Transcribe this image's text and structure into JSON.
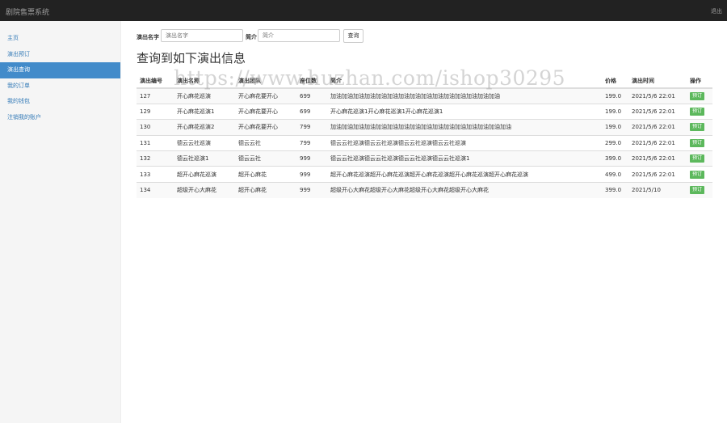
{
  "app": {
    "title": "剧院售票系统",
    "logout_label": "退出"
  },
  "sidebar": {
    "items": [
      {
        "label": "主页",
        "active": false
      },
      {
        "label": "演出预订",
        "active": false
      },
      {
        "label": "演出查询",
        "active": true
      },
      {
        "label": "我的订单",
        "active": false
      },
      {
        "label": "我的钱包",
        "active": false
      },
      {
        "label": "注销我的账户",
        "active": false
      }
    ]
  },
  "search": {
    "name_label": "演出名字",
    "name_placeholder": "演出名字",
    "desc_label": "简介",
    "desc_placeholder": "简介",
    "button_label": "查询"
  },
  "page_title": "查询到如下演出信息",
  "watermark": "https://www.huzhan.com/ishop30295",
  "table": {
    "headers": [
      "演出编号",
      "演出名称",
      "演出团队",
      "座位数",
      "简介",
      "价格",
      "演出时间",
      "操作"
    ],
    "rows": [
      [
        "127",
        "开心麻花巡演",
        "开心麻花要开心",
        "699",
        "加油加油加油加油加油加油加油加油加油加油加油加油加油加油加油",
        "199.0",
        "2021/5/6 22:01",
        "预订"
      ],
      [
        "129",
        "开心麻花巡演1",
        "开心麻花要开心",
        "699",
        "开心麻花巡演1开心麻花巡演1开心麻花巡演1",
        "199.0",
        "2021/5/6 22:01",
        "预订"
      ],
      [
        "130",
        "开心麻花巡演2",
        "开心麻花要开心",
        "799",
        "加油加油加油加油加油加油加油加油加油加油加油加油加油加油加油加油",
        "199.0",
        "2021/5/6 22:01",
        "预订"
      ],
      [
        "131",
        "德云云社巡演",
        "德云云社",
        "799",
        "德云云社巡演德云云社巡演德云云社巡演德云云社巡演",
        "299.0",
        "2021/5/6 22:01",
        "预订"
      ],
      [
        "132",
        "德云社巡演1",
        "德云云社",
        "999",
        "德云云社巡演德云云社巡演德云云社巡演德云云社巡演1",
        "399.0",
        "2021/5/6 22:01",
        "预订"
      ],
      [
        "133",
        "超开心麻花巡演",
        "超开心麻花",
        "999",
        "超开心麻花巡演超开心麻花巡演超开心麻花巡演超开心麻花巡演超开心麻花巡演",
        "499.0",
        "2021/5/6 22:01",
        "预订"
      ],
      [
        "134",
        "超级开心大麻花",
        "超开心麻花",
        "999",
        "超级开心大麻花超级开心大麻花超级开心大麻花超级开心大麻花",
        "399.0",
        "2021/5/10",
        "预订"
      ]
    ]
  },
  "colors": {
    "topbar": "#222222",
    "active_nav": "#428bca",
    "book_button": "#5cb85c",
    "link": "#337ab7"
  }
}
